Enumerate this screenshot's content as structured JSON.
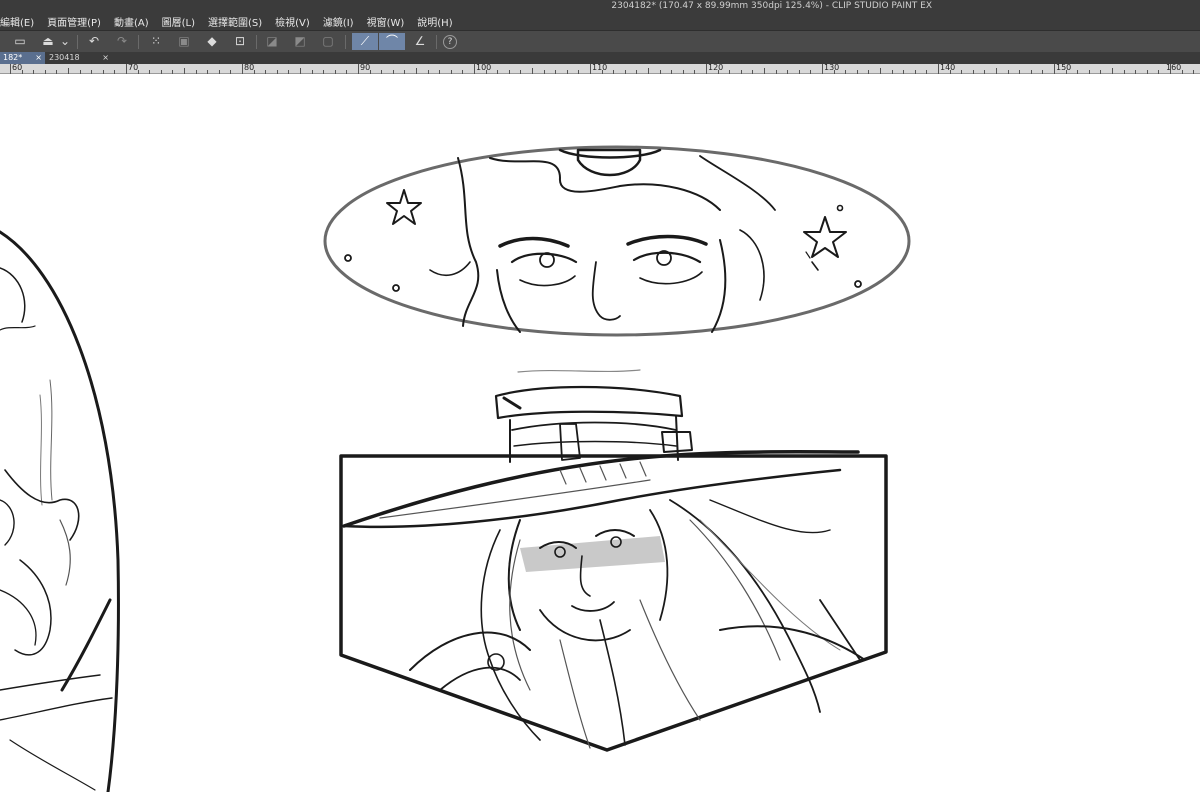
{
  "window": {
    "title": "2304182* (170.47 x 89.99mm 350dpi 125.4%) - CLIP STUDIO PAINT EX"
  },
  "menu": {
    "items": [
      {
        "label": "編輯(E)"
      },
      {
        "label": "頁面管理(P)"
      },
      {
        "label": "動畫(A)"
      },
      {
        "label": "圖層(L)"
      },
      {
        "label": "選擇範圍(S)"
      },
      {
        "label": "檢視(V)"
      },
      {
        "label": "濾鏡(I)"
      },
      {
        "label": "視窗(W)"
      },
      {
        "label": "說明(H)"
      }
    ]
  },
  "toolbar": {
    "buttons": [
      {
        "name": "open-file-icon",
        "glyph": "▭"
      },
      {
        "name": "save-icon",
        "glyph": "⏏"
      },
      {
        "name": "save-dropdown-icon",
        "glyph": "⌄"
      },
      {
        "name": "undo-icon",
        "glyph": "↶"
      },
      {
        "name": "redo-icon",
        "glyph": "↷"
      },
      {
        "name": "clear-selection-icon",
        "glyph": "⁙"
      },
      {
        "name": "layer-copy-icon",
        "glyph": "▣"
      },
      {
        "name": "fill-icon",
        "glyph": "◆"
      },
      {
        "name": "transform-icon",
        "glyph": "⊡"
      },
      {
        "name": "hide-outside-selection-icon",
        "glyph": "◪"
      },
      {
        "name": "gradient-icon",
        "glyph": "◩"
      },
      {
        "name": "canvas-frame-icon",
        "glyph": "▢"
      },
      {
        "name": "stabilization-icon",
        "glyph": "⟋"
      },
      {
        "name": "brush-pressure-icon",
        "glyph": "⌒"
      },
      {
        "name": "ruler-snap-icon",
        "glyph": "∠"
      },
      {
        "name": "help-icon",
        "glyph": "?"
      }
    ]
  },
  "tabs": [
    {
      "label": "182*",
      "close": "×"
    },
    {
      "label": "230418",
      "close": "×"
    }
  ],
  "ruler": {
    "labels": [
      "60",
      "70",
      "80",
      "90",
      "100",
      "110",
      "120",
      "130",
      "140",
      "150",
      "160"
    ]
  },
  "colors": {
    "menubar": "#3b3b3b",
    "toolbar": "#4a4a4a",
    "active_button": "#6f86a8",
    "active_tab": "#5a6f8f",
    "ruler": "#d9d9d9",
    "canvas": "#ffffff",
    "ink": "#1a1a1a"
  }
}
